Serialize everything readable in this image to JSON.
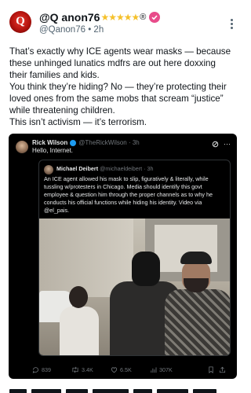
{
  "post": {
    "avatar_letter": "Q",
    "display_name": "@Q anon76",
    "stars": "★★★★★",
    "reg_mark": "®",
    "handle": "@Qanon76",
    "time": "• 2h",
    "more_icon": "more-dots-icon",
    "lines": [
      "That’s exactly why ICE agents wear masks — because",
      "these unhinged lunatics mdfrs are out here doxxing",
      "their families and kids.",
      "You think they’re hiding? No — they’re protecting their",
      "loved ones from the same mobs that scream “justice”",
      "while threatening children.",
      "This isn’t activism — it’s terrorism."
    ]
  },
  "embed": {
    "name": "Rick Wilson",
    "handle": "@TheRickWilson · 3h",
    "text": "Hello, Internet.",
    "quote": {
      "name": "Michael Deibert",
      "handle": "@michaeldeibert · 3h",
      "lines": [
        "An ICE agent allowed his mask to slip, figuratively & literally, while",
        "tussling w/protesters in Chicago. Media should identify this govt",
        "employee & question him through the proper channels as to why he",
        "conducts his official functions while hiding his identity. Video via",
        "@el_pais."
      ]
    },
    "stats": {
      "replies": "839",
      "reposts": "3.4K",
      "likes": "6.5K",
      "views": "307K"
    }
  },
  "colors": {
    "accent_blue": "#1d9bf0",
    "badge_pink": "#e84b8a",
    "star_gold": "#f5c12b"
  }
}
